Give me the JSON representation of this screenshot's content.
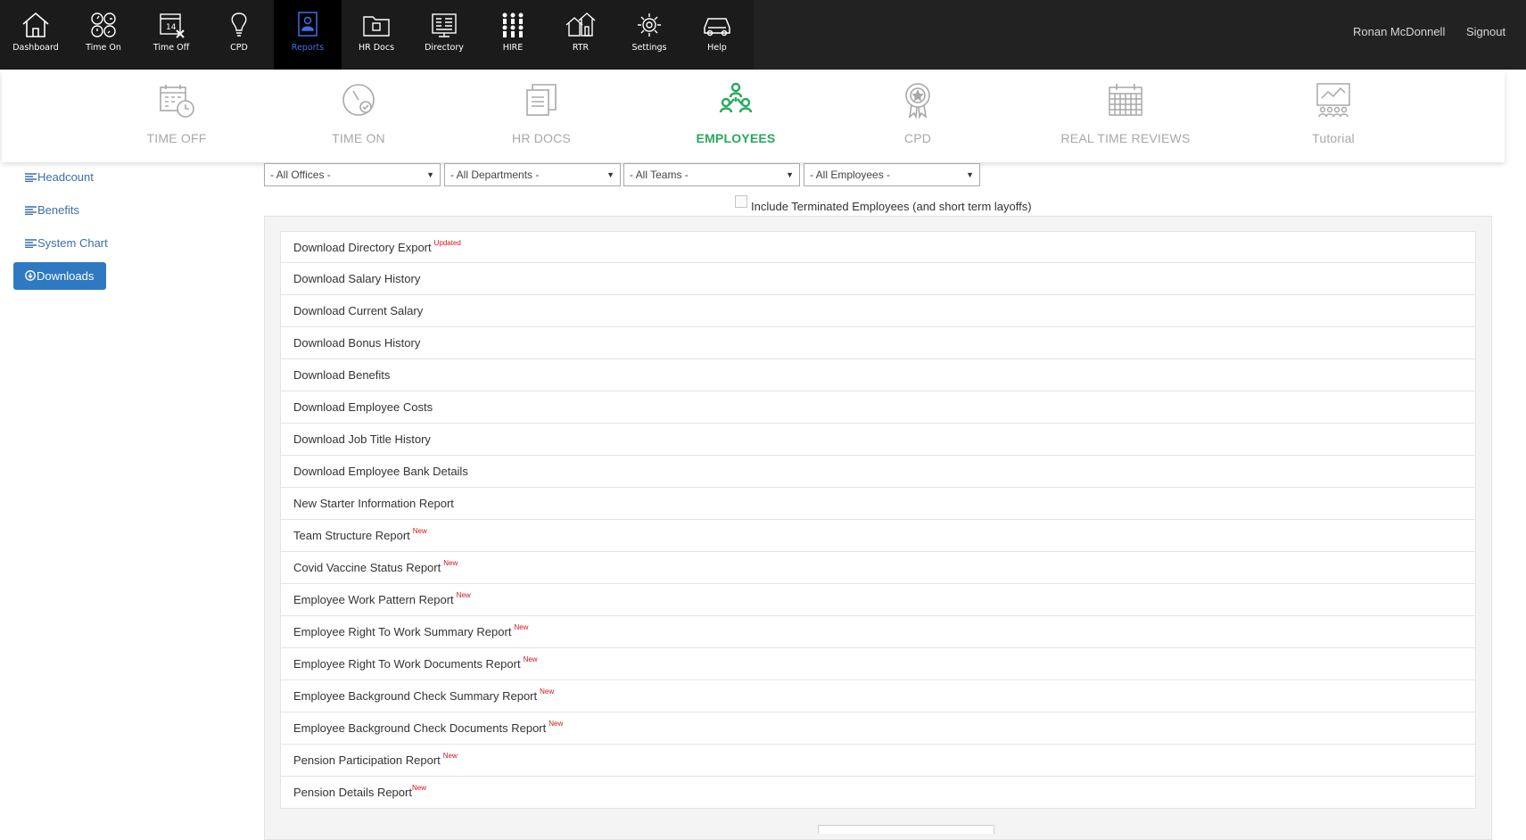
{
  "nav": {
    "items": [
      {
        "label": "Dashboard",
        "icon": "house-icon"
      },
      {
        "label": "Time On",
        "icon": "clocks-icon"
      },
      {
        "label": "Time Off",
        "icon": "calendar-x-icon"
      },
      {
        "label": "CPD",
        "icon": "lightbulb-icon"
      },
      {
        "label": "Reports",
        "icon": "report-person-icon"
      },
      {
        "label": "HR Docs",
        "icon": "folder-icon"
      },
      {
        "label": "Directory",
        "icon": "directory-icon"
      },
      {
        "label": "HIRE",
        "icon": "people-grid-icon"
      },
      {
        "label": "RTR",
        "icon": "houses-icon"
      },
      {
        "label": "Settings",
        "icon": "gear-icon"
      },
      {
        "label": "Help",
        "icon": "car-icon"
      }
    ],
    "active": "Reports",
    "active_color": "#3f6fe0",
    "user": "Ronan McDonnell",
    "signout": "Signout"
  },
  "subnav": {
    "items": [
      {
        "label": "TIME OFF",
        "icon": "calendar-clock-icon"
      },
      {
        "label": "TIME ON",
        "icon": "stopwatch-icon"
      },
      {
        "label": "HR DOCS",
        "icon": "documents-icon"
      },
      {
        "label": "EMPLOYEES",
        "icon": "employees-icon"
      },
      {
        "label": "CPD",
        "icon": "award-icon"
      },
      {
        "label": "REAL TIME REVIEWS",
        "icon": "calendar-grid-icon"
      },
      {
        "label": "Tutorial",
        "icon": "presentation-icon"
      }
    ],
    "active": "EMPLOYEES",
    "active_color": "#2aa85c"
  },
  "sidebar": {
    "items": [
      "Headcount",
      "Benefits",
      "System Chart"
    ],
    "button": "Downloads",
    "button_color": "#2f79c2"
  },
  "filters": {
    "offices": "- All Offices -",
    "departments": "- All Departments -",
    "teams": "- All Teams -",
    "employees": "- All Employees -",
    "terminated_label": "Include Terminated Employees (and short term layoffs)"
  },
  "downloads": [
    {
      "label": "Download Directory Export",
      "badge": "Updated"
    },
    {
      "label": "Download Salary History",
      "badge": ""
    },
    {
      "label": "Download Current Salary",
      "badge": ""
    },
    {
      "label": "Download Bonus History",
      "badge": ""
    },
    {
      "label": "Download Benefits",
      "badge": ""
    },
    {
      "label": "Download Employee Costs",
      "badge": ""
    },
    {
      "label": "Download Job Title History",
      "badge": ""
    },
    {
      "label": "Download Employee Bank Details",
      "badge": ""
    },
    {
      "label": "New Starter Information Report",
      "badge": ""
    },
    {
      "label": "Team Structure Report",
      "badge": "New"
    },
    {
      "label": "Covid Vaccine Status Report",
      "badge": "New"
    },
    {
      "label": "Employee Work Pattern Report",
      "badge": "New"
    },
    {
      "label": "Employee Right To Work Summary Report",
      "badge": "New"
    },
    {
      "label": "Employee Right To Work Documents Report",
      "badge": "New"
    },
    {
      "label": "Employee Background Check Summary Report",
      "badge": "New"
    },
    {
      "label": "Employee Background Check Documents Report",
      "badge": "New"
    },
    {
      "label": "Pension Participation Report",
      "badge": "New"
    },
    {
      "label": "Pension Details Report",
      "badge": "New"
    }
  ],
  "badge_color": "#d01818"
}
